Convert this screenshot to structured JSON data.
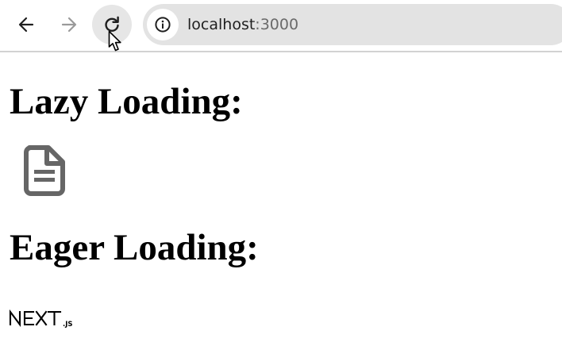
{
  "browser": {
    "url_host": "localhost",
    "url_port": ":3000"
  },
  "content": {
    "lazy_heading": "Lazy Loading:",
    "lazy_image": "broken-image-placeholder-icon",
    "eager_heading": "Eager Loading:",
    "eager_image": {
      "text": "NEXT",
      "suffix": ".JS"
    }
  }
}
